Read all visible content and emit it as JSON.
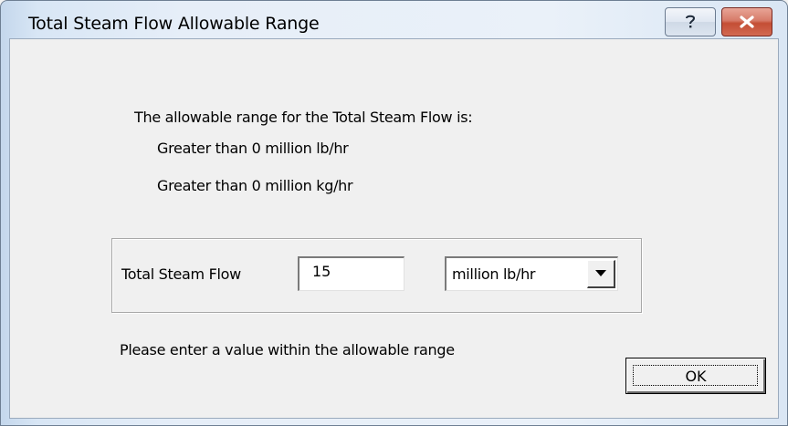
{
  "window": {
    "title": "Total Steam Flow Allowable Range",
    "help_icon": "question-mark-icon",
    "close_icon": "close-x-icon"
  },
  "info": {
    "heading": "The allowable range for the Total Steam Flow is:",
    "range_lb": "Greater than 0 million lb/hr",
    "range_kg": "Greater than 0 million kg/hr"
  },
  "form": {
    "field_label": "Total Steam Flow",
    "field_value": "15",
    "unit_selected": "million lb/hr",
    "dropdown_icon": "chevron-down-icon"
  },
  "message": "Please enter a value within the allowable range",
  "buttons": {
    "ok_label": "OK"
  },
  "colors": {
    "close_button": "#c44e35",
    "client_background": "#f0f0f0"
  }
}
